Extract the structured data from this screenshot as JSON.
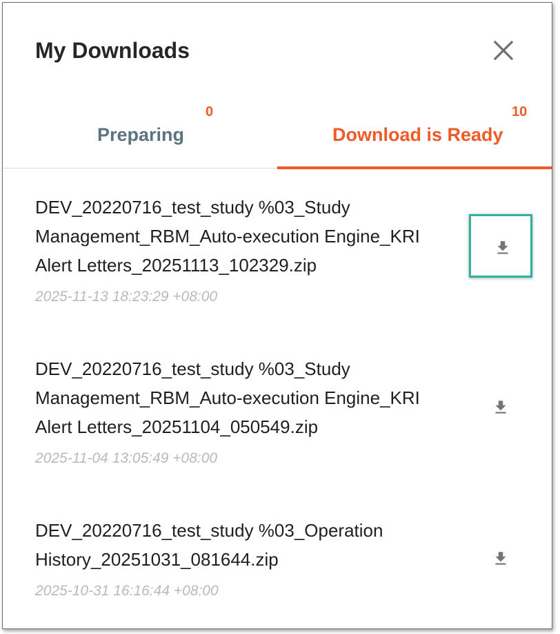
{
  "dialog": {
    "title": "My Downloads"
  },
  "tabs": [
    {
      "label": "Preparing",
      "count": "0",
      "active": false
    },
    {
      "label": "Download is Ready",
      "count": "10",
      "active": true
    }
  ],
  "colors": {
    "accent": "#f05a28",
    "inactive_tab": "#5c7480",
    "focus_ring": "#2bb3a0",
    "timestamp": "#b9b9b9"
  },
  "downloads": [
    {
      "name": "DEV_20220716_test_study %03_Study Management_RBM_Auto-execution Engine_KRI Alert Letters_20251113_102329.zip",
      "time": "2025-11-13 18:23:29 +08:00",
      "icon": "download-icon"
    },
    {
      "name": "DEV_20220716_test_study %03_Study Management_RBM_Auto-execution Engine_KRI Alert Letters_20251104_050549.zip",
      "time": "2025-11-04 13:05:49 +08:00",
      "icon": "download-icon"
    },
    {
      "name": "DEV_20220716_test_study %03_Operation History_20251031_081644.zip",
      "time": "2025-10-31 16:16:44 +08:00",
      "icon": "download-icon"
    }
  ]
}
